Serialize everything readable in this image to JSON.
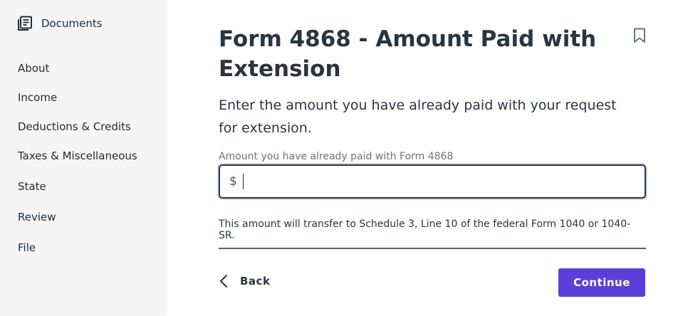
{
  "sidebar": {
    "documents_label": "Documents",
    "items": [
      {
        "label": "About"
      },
      {
        "label": "Income"
      },
      {
        "label": "Deductions & Credits"
      },
      {
        "label": "Taxes & Miscellaneous"
      },
      {
        "label": "State"
      },
      {
        "label": "Review"
      },
      {
        "label": "File"
      }
    ]
  },
  "main": {
    "title": "Form 4868 - Amount Paid with Extension",
    "description": "Enter the amount you have already paid with your request for extension.",
    "field_label": "Amount you have already paid with Form 4868",
    "currency_symbol": "$",
    "amount_value": "",
    "note": "This amount will transfer to Schedule 3, Line 10 of the federal Form 1040 or 1040-SR.",
    "back_label": "Back",
    "continue_label": "Continue"
  },
  "colors": {
    "accent": "#5b3fd8",
    "sidebar_bg": "#f5f5f5",
    "text": "#2b3440"
  },
  "icons": {
    "documents": "documents-icon",
    "bookmark": "bookmark-icon",
    "back": "chevron-left-icon"
  }
}
